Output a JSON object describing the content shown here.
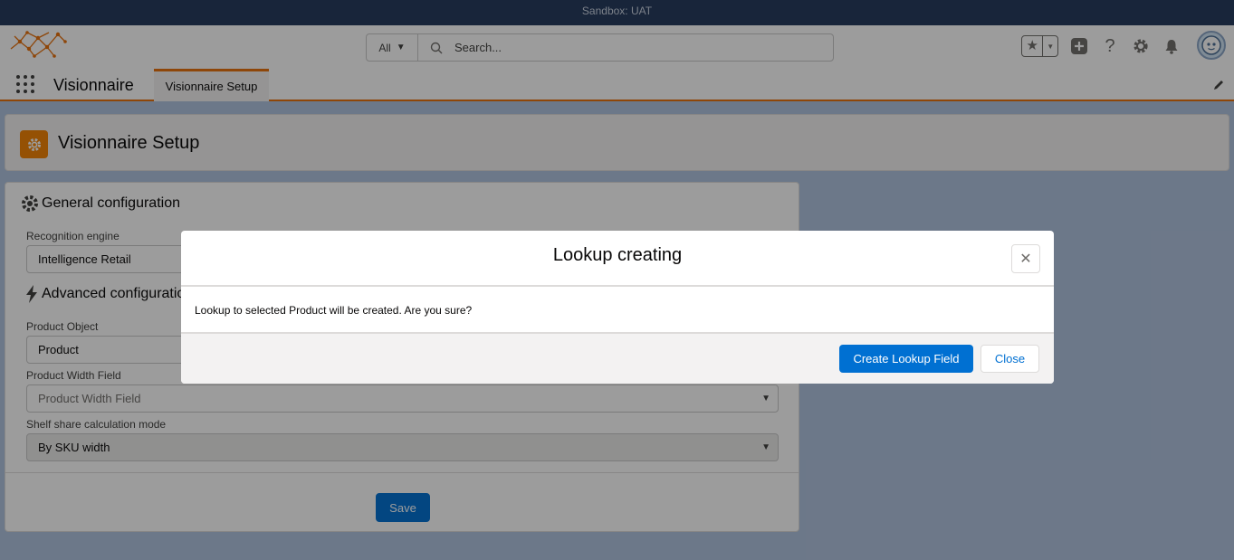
{
  "sandbox_bar": {
    "text": "Sandbox: UAT"
  },
  "global_header": {
    "search": {
      "scope": "All",
      "placeholder": "Search..."
    },
    "icons": [
      "favorites-star-icon",
      "plus-icon",
      "help-icon",
      "setup-gear-icon",
      "notification-bell-icon",
      "avatar"
    ]
  },
  "app_bar": {
    "app_name": "Visionnaire",
    "tabs": [
      {
        "label": "Visionnaire Setup",
        "active": true
      }
    ]
  },
  "page_header": {
    "title": "Visionnaire Setup"
  },
  "card": {
    "general_section": {
      "title": "General configuration"
    },
    "recognition_engine": {
      "label": "Recognition engine",
      "value": "Intelligence Retail"
    },
    "advanced_section": {
      "title": "Advanced configuratio"
    },
    "product_object": {
      "label": "Product Object",
      "value": "Product"
    },
    "product_width_field": {
      "label": "Product Width Field",
      "placeholder": "Product Width Field"
    },
    "shelf_share_mode": {
      "label": "Shelf share calculation mode",
      "value": "By SKU width"
    },
    "save_label": "Save"
  },
  "modal": {
    "title": "Lookup creating",
    "body": "Lookup to selected Product will be created. Are you sure?",
    "primary_label": "Create Lookup Field",
    "close_label": "Close"
  },
  "colors": {
    "brand_primary": "#0070d2",
    "accent_orange": "#e8710a",
    "sandbox_bar": "#23395d"
  }
}
